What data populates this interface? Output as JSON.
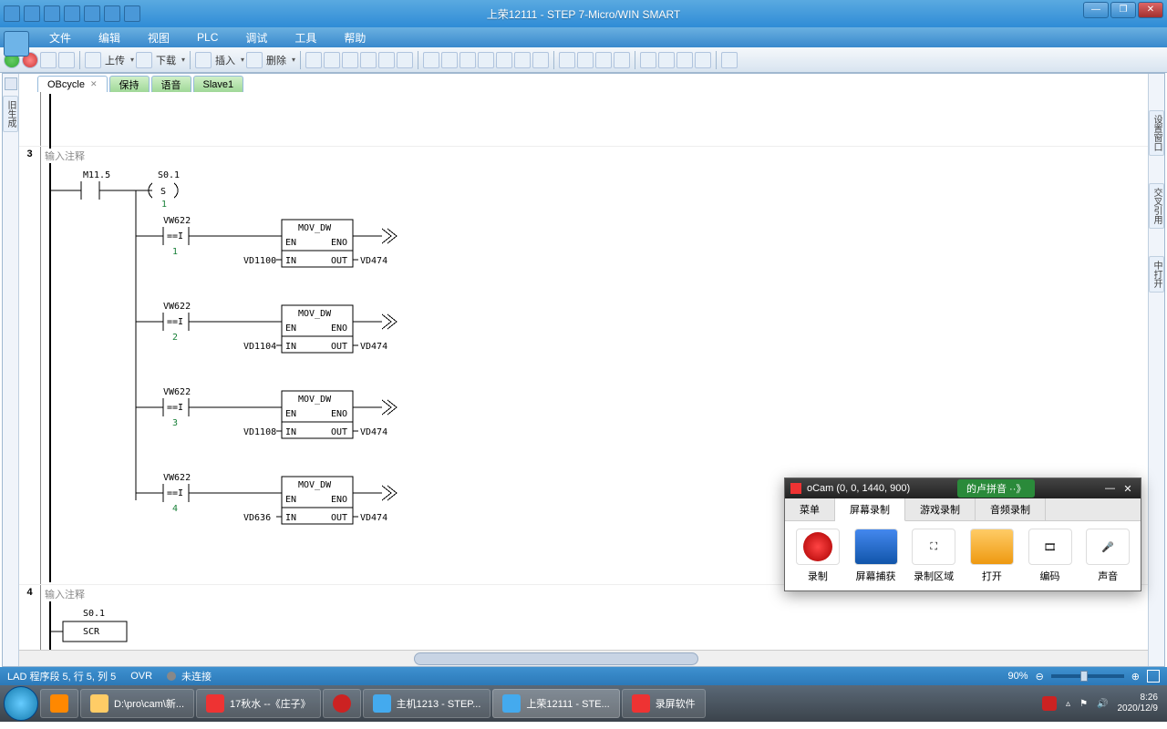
{
  "title": "上荣12111 - STEP 7-Micro/WIN SMART",
  "menu": [
    "文件",
    "编辑",
    "视图",
    "PLC",
    "调试",
    "工具",
    "帮助"
  ],
  "toolbar": {
    "upload": "上传",
    "download": "下载",
    "insert": "插入",
    "delete": "删除"
  },
  "tabs": [
    {
      "label": "OBcycle",
      "active": true,
      "closable": true
    },
    {
      "label": "保持",
      "green": true
    },
    {
      "label": "语音",
      "green": true
    },
    {
      "label": "Slave1",
      "green": true
    }
  ],
  "sideRight": [
    "设置窗口",
    "交叉引用",
    "中打开"
  ],
  "networks": [
    {
      "num": "3",
      "comment": "输入注释",
      "items": {
        "contact1": "M11.5",
        "coil": "S0.1",
        "coil_type": "S",
        "coil_n": "1",
        "branches": [
          {
            "cmp": "VW622",
            "eq": "1",
            "box": "MOV_DW",
            "in": "VD1100",
            "out": "VD474"
          },
          {
            "cmp": "VW622",
            "eq": "2",
            "box": "MOV_DW",
            "in": "VD1104",
            "out": "VD474"
          },
          {
            "cmp": "VW622",
            "eq": "3",
            "box": "MOV_DW",
            "in": "VD1108",
            "out": "VD474"
          },
          {
            "cmp": "VW622",
            "eq": "4",
            "box": "MOV_DW",
            "in": "VD636",
            "out": "VD474"
          }
        ]
      }
    },
    {
      "num": "4",
      "comment": "输入注释",
      "scr": "S0.1",
      "scr_lbl": "SCR"
    }
  ],
  "status": {
    "left": "LAD 程序段 5, 行 5, 列 5",
    "ovr": "OVR",
    "conn": "未连接",
    "zoom": "90%"
  },
  "ocam": {
    "title": "oCam (0, 0, 1440, 900)",
    "tabs": [
      "菜单",
      "屏幕录制",
      "游戏录制",
      "音频录制"
    ],
    "tools": [
      "录制",
      "屏幕捕获",
      "录制区域",
      "打开",
      "编码",
      "声音"
    ]
  },
  "ime": "的卢拼音 ··》",
  "taskbar": [
    {
      "label": "D:\\pro\\cam\\新..."
    },
    {
      "label": "17秋水 --《庄子》"
    },
    {
      "label": ""
    },
    {
      "label": "主机1213 - STEP..."
    },
    {
      "label": "上荣12111 - STE...",
      "active": true
    },
    {
      "label": "录屏软件"
    }
  ],
  "tray": {
    "time": "8:26",
    "date": "2020/12/9"
  }
}
